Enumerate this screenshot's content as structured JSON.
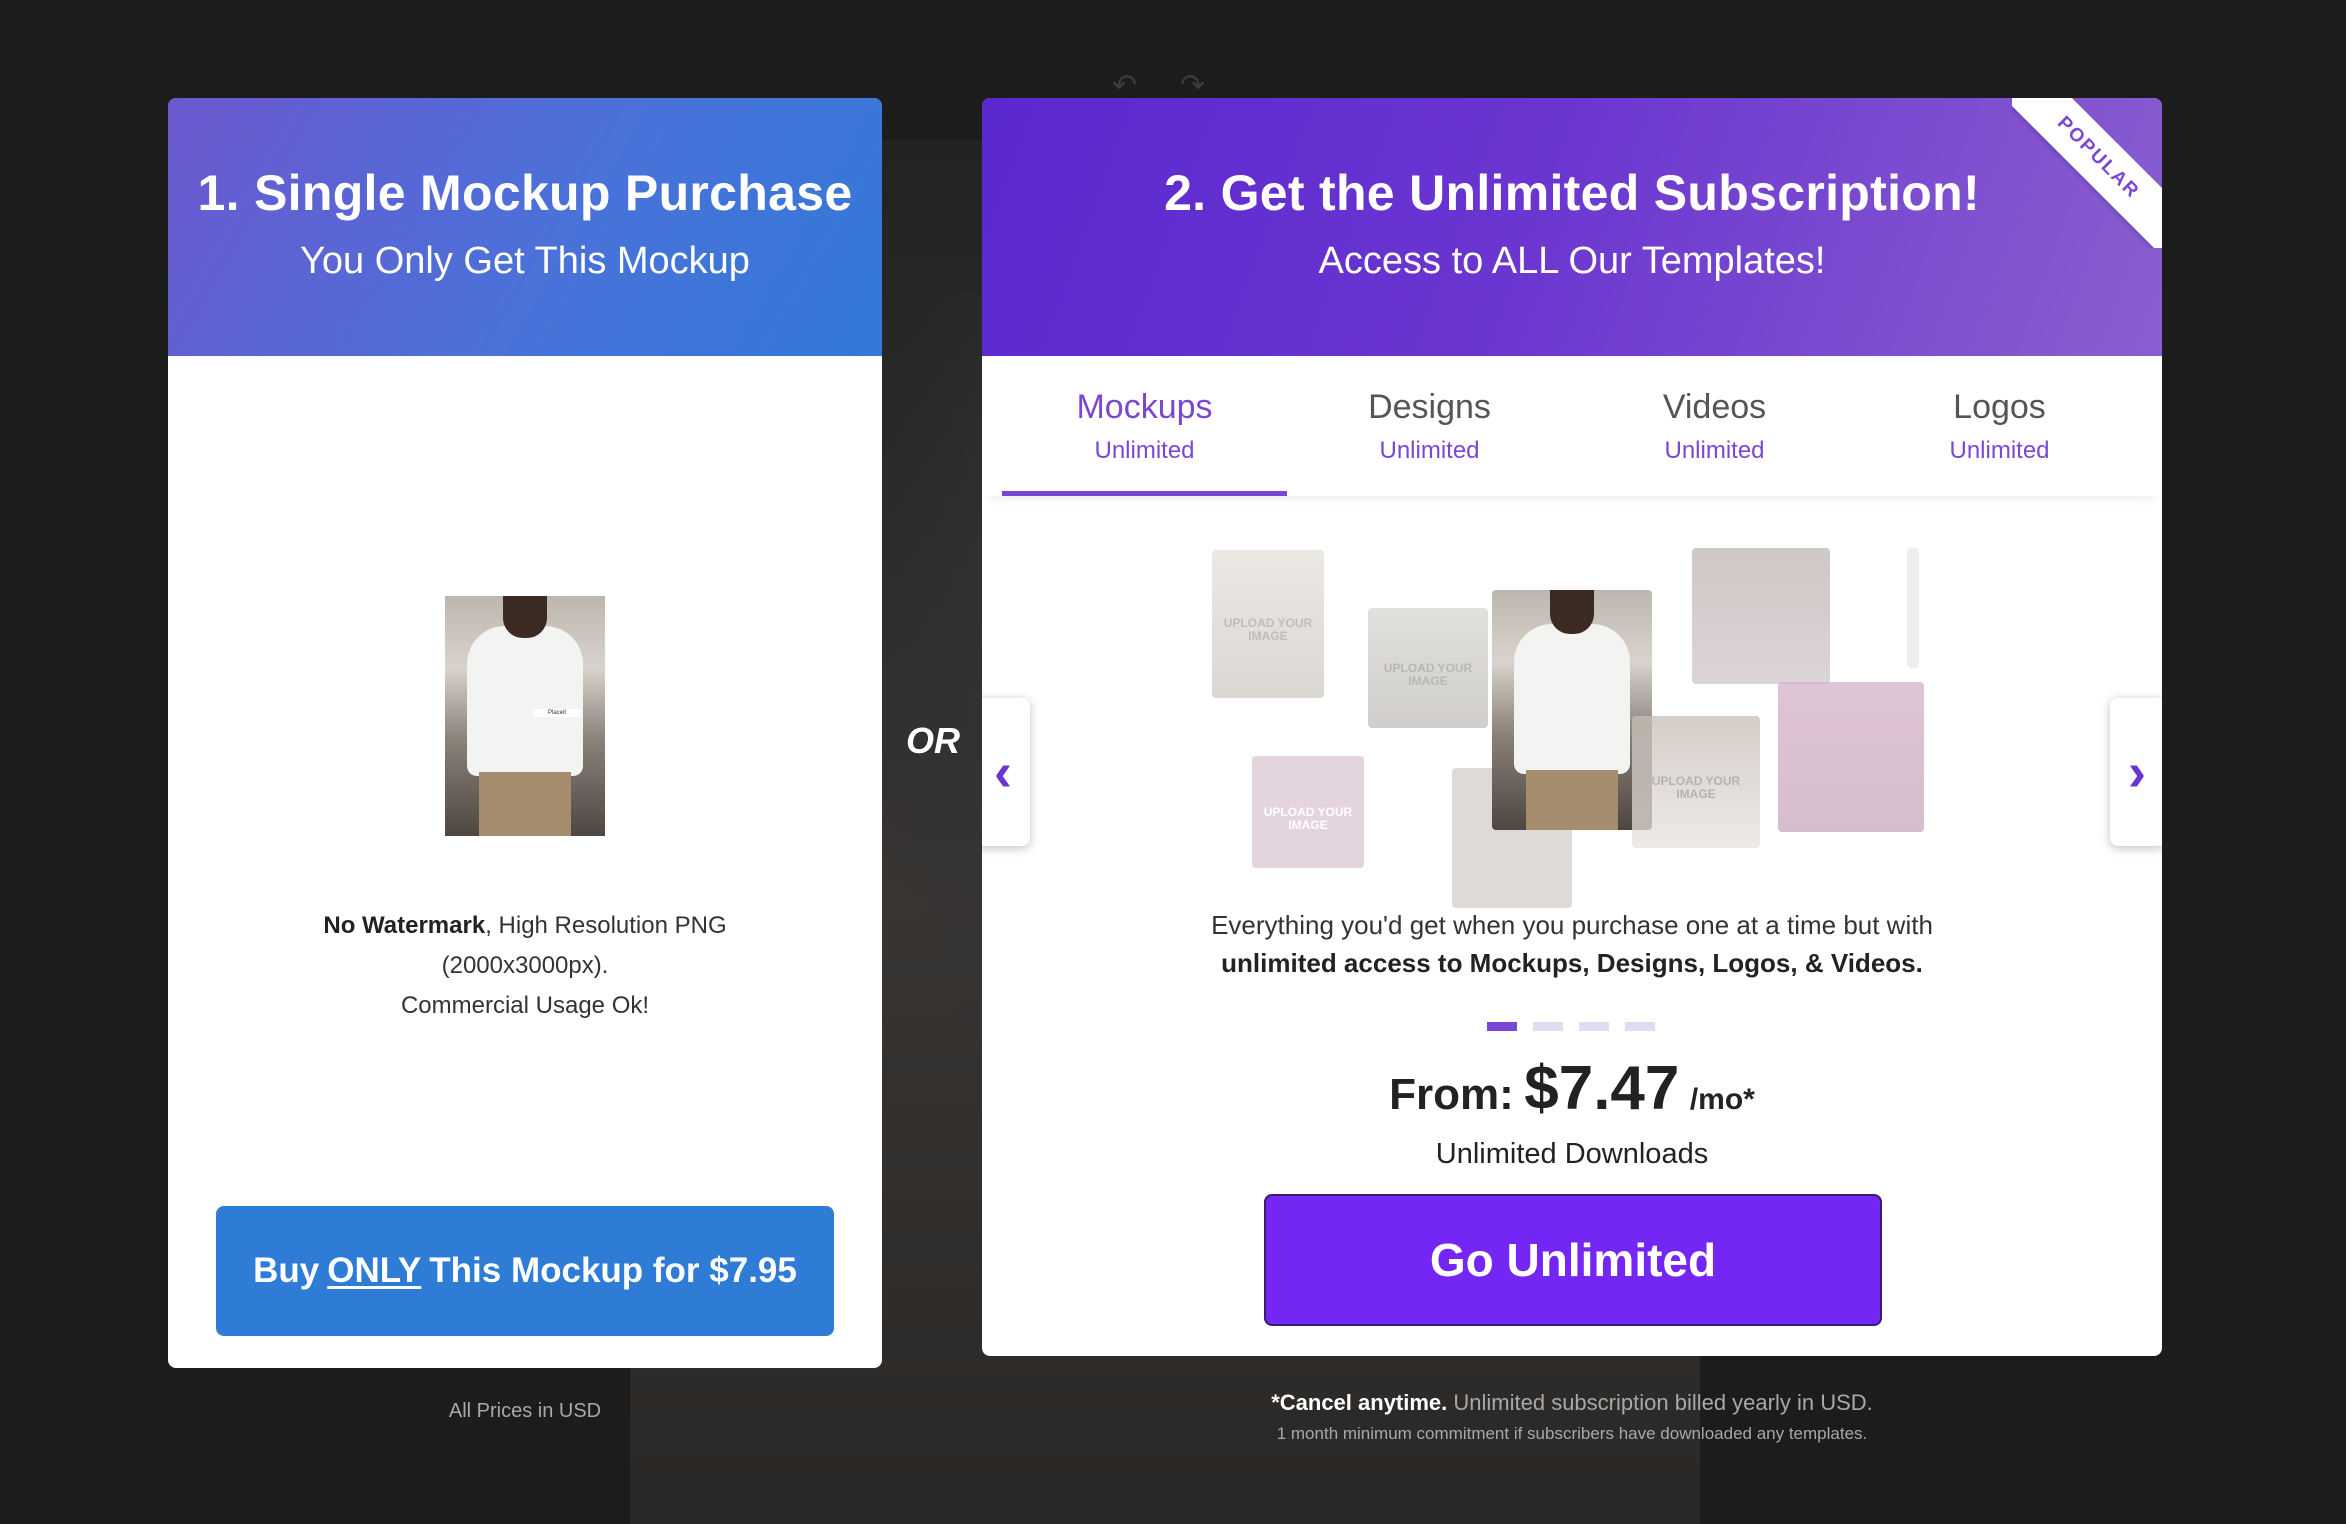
{
  "single": {
    "title": "1. Single Mockup Purchase",
    "subtitle": "You Only Get This Mockup",
    "desc_bold": "No Watermark",
    "desc_rest": ", High Resolution PNG",
    "desc_line2": "(2000x3000px).",
    "desc_line3": "Commercial Usage Ok!",
    "buy_prefix": "Buy",
    "buy_emph": "ONLY",
    "buy_suffix": "This Mockup for $7.95",
    "prices_note": "All Prices in USD"
  },
  "or_label": "OR",
  "subscription": {
    "title": "2. Get the Unlimited Subscription!",
    "subtitle": "Access to ALL Our Templates!",
    "ribbon": "POPULAR",
    "tabs": [
      {
        "name": "Mockups",
        "sub": "Unlimited"
      },
      {
        "name": "Designs",
        "sub": "Unlimited"
      },
      {
        "name": "Videos",
        "sub": "Unlimited"
      },
      {
        "name": "Logos",
        "sub": "Unlimited"
      }
    ],
    "placeholder": "UPLOAD YOUR IMAGE",
    "desc_line1": "Everything you'd get when you purchase one at a time but with",
    "desc_line2": "unlimited access to Mockups, Designs, Logos, & Videos.",
    "price_from": "From:",
    "price_value": "$7.47",
    "price_per": "/mo*",
    "unlimited_downloads": "Unlimited Downloads",
    "cta": "Go Unlimited",
    "cancel_bold": "*Cancel anytime.",
    "cancel_rest": " Unlimited subscription billed yearly in USD.",
    "commitment": "1 month minimum commitment if subscribers have downloaded any templates."
  }
}
